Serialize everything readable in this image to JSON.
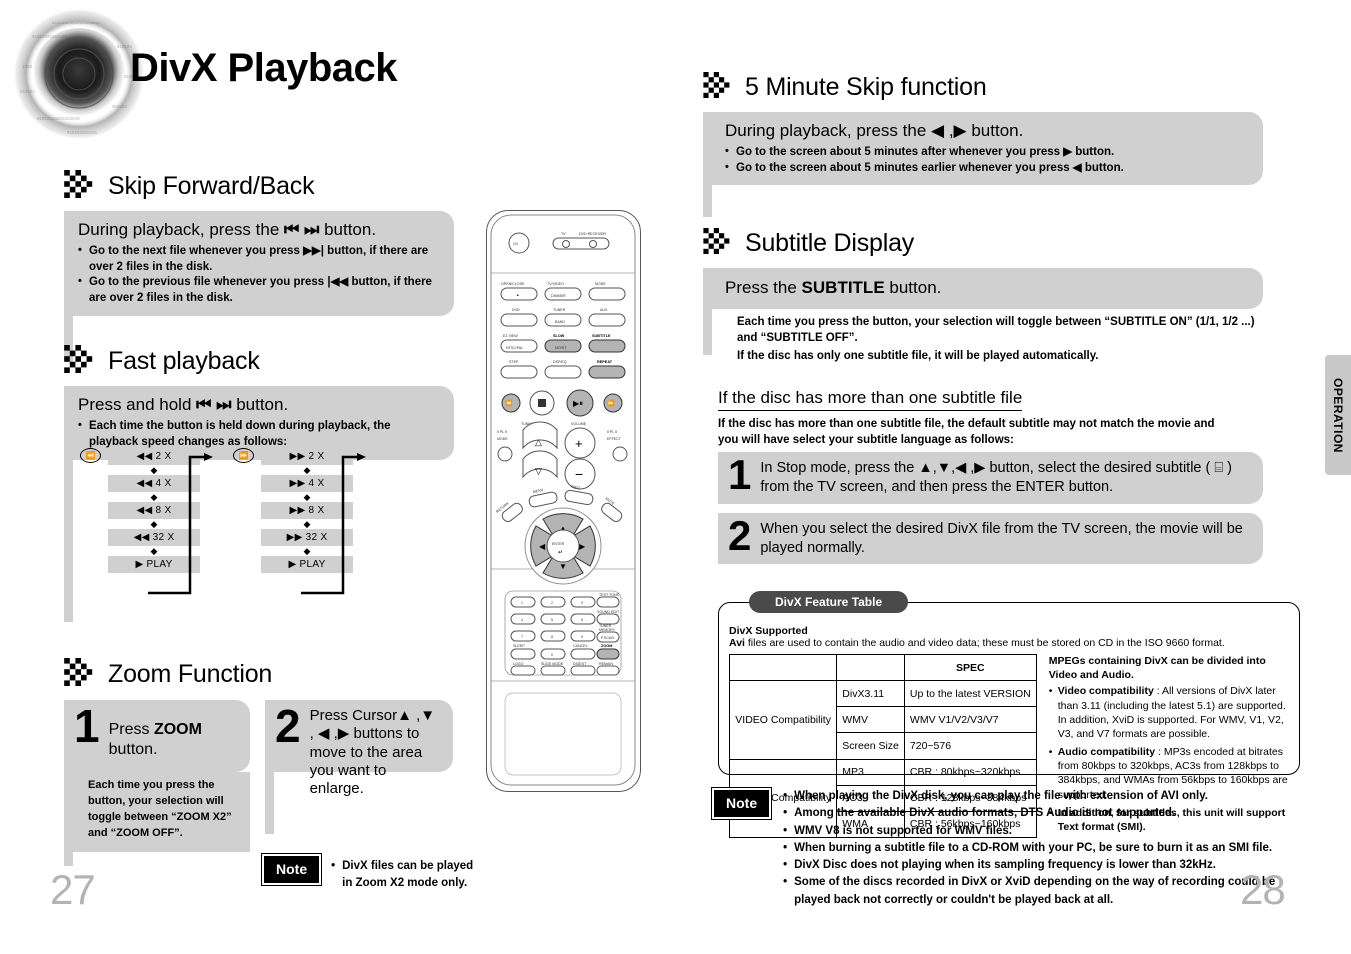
{
  "document": {
    "title": "DivX Playback",
    "side_tab": "OPERATION",
    "left_page_number": "27",
    "right_page_number": "28"
  },
  "sections": {
    "skip": {
      "heading": "Skip Forward/Back",
      "lead_prefix": "During playback, press the",
      "lead_icons": "⏮ ⏭",
      "lead_suffix": "button.",
      "bullets": [
        "Go to the next file whenever you press ▶▶| button, if there are over 2 files in the disk.",
        "Go to the previous file whenever you press |◀◀ button, if there are over 2 files in the disk."
      ]
    },
    "fast": {
      "heading": "Fast playback",
      "lead_prefix": "Press and hold",
      "lead_icons": "⏮ ⏭",
      "lead_suffix": "button.",
      "bullets": [
        "Each time the button is held down during playback, the playback speed changes as follows:"
      ],
      "chain_left": {
        "button_icon": "⏮",
        "steps": [
          "◀◀  2 X",
          "◀◀  4 X",
          "◀◀  8 X",
          "◀◀ 32 X",
          "▶  PLAY"
        ]
      },
      "chain_right": {
        "button_icon": "⏭",
        "steps": [
          "▶▶  2 X",
          "▶▶  4 X",
          "▶▶  8 X",
          "▶▶ 32 X",
          "▶  PLAY"
        ]
      }
    },
    "zoom": {
      "heading": "Zoom Function",
      "step1_num": "1",
      "step1_text_a": "Press ",
      "step1_text_b": "ZOOM",
      "step1_text_c": " button.",
      "step2_num": "2",
      "step2_text": "Press Cursor▲ ,▼ , ◀ ,▶ buttons to move to the area you want to enlarge.",
      "bullet": "Each time you press the button, your selection will toggle between “ZOOM X2” and “ZOOM OFF”.",
      "note_label": "Note",
      "note_text": "DivX files can be played in Zoom X2 mode only."
    },
    "five_min": {
      "heading": "5 Minute Skip function",
      "lead_prefix": "During playback, press the",
      "lead_icons": "◀ ,▶",
      "lead_suffix": "button.",
      "bullets": [
        "Go to the screen about 5 minutes after whenever you press ▶ button.",
        "Go to the screen about 5 minutes earlier whenever you press ◀ button."
      ]
    },
    "subtitle": {
      "heading": "Subtitle Display",
      "lead_a": "Press the ",
      "lead_b": "SUBTITLE",
      "lead_c": " button.",
      "bullets": [
        "Each time you press the button, your selection will toggle between “SUBTITLE ON” (1/1, 1/2 ...) and “SUBTITLE OFF”.",
        "If the disc has only one subtitle file, it will be played automatically."
      ],
      "sub_heading": "If the disc has more than one subtitle file",
      "sub_intro": "If the disc has more than one subtitle file, the default subtitle may not match the movie and you will have select your subtitle language as follows:",
      "step1_num": "1",
      "step1_text": "In Stop mode, press the ▲,▼,◀ ,▶ button, select the desired subtitle ( ⌸ ) from the TV screen, and then press the ENTER button.",
      "step2_num": "2",
      "step2_text": "When you select the desired DivX file from the TV screen, the movie will be played normally."
    },
    "feature_table": {
      "tab_label": "DivX Feature Table",
      "supported_title": "DivX Supported",
      "supported_text_bold": "Avi",
      "supported_text": " files are used to contain the audio and video data; these must be stored on CD in the ISO 9660 format.",
      "table": {
        "header": [
          "",
          "",
          "SPEC"
        ],
        "rows": [
          {
            "group": "VIDEO Compatibility",
            "items": [
              {
                "name": "DivX3.11",
                "spec": "Up to the latest VERSION"
              },
              {
                "name": "WMV",
                "spec": "WMV V1/V2/V3/V7"
              },
              {
                "name": "Screen Size",
                "spec": "720~576"
              }
            ]
          },
          {
            "group": "AUDIO Compatibility",
            "items": [
              {
                "name": "MP3",
                "spec": "CBR : 80kbps~320kbps"
              },
              {
                "name": "AC3",
                "spec": "CBR : 128kbps~384kbps"
              },
              {
                "name": "WMA",
                "spec": "CBR : 56kbps~160kbps"
              }
            ]
          }
        ]
      },
      "right_heading": "MPEGs containing DivX can be divided into Video and Audio.",
      "right_items": [
        {
          "bold": "Video compatibility",
          "text": " : All versions of DivX later than 3.11 (including the latest 5.1) are supported. In addition, XviD is supported. For WMV, V1, V2, V3, and V7 formats are possible."
        },
        {
          "bold": "Audio compatibility",
          "text": " : MP3s encoded at bitrates from 80kbps to 320kbps, AC3s from 128kbps to 384kbps, and WMAs from 56kbps to 160kbps are supported."
        },
        {
          "bold": "In addition, for subtitles, this unit will support Text format (SMI).",
          "text": ""
        }
      ]
    },
    "bottom_note": {
      "label": "Note",
      "items": [
        "When playing the DivX disk, you can play the file with extension of AVI only.",
        "Among the available DivX audio formats, DTS Audio is not supported.",
        "WMV V8 is not supported for WMV files.",
        "When burning a subtitle file to a CD-ROM with your PC, be sure to burn it as an SMI file.",
        "DivX Disc does not playing when its sampling frequency is lower than 32kHz.",
        "Some of the discs recorded in DivX or XviD depending on the way of recording could be played back not correctly or couldn't be played back at all."
      ]
    }
  },
  "remote": {
    "power_icon": "⏻/I",
    "labels": {
      "tv": "TV",
      "dvd_receiver": "DVD RECEIVER",
      "open_close": "OPEN/CLOSE",
      "tv_video": "TV/VIDEO",
      "dimmer": "DIMMER",
      "mode": "MODE",
      "dvd": "DVD",
      "tuner": "TUNER",
      "band": "BAND",
      "aux": "AUX",
      "ez_view": "EZ VIEW",
      "ntsc_pal": "NTSC/PAL",
      "slow": "SLOW",
      "mo_st": "MO/ST",
      "subtitle": "SUBTITLE",
      "step": "STEP",
      "dsp_eq": "DSP/EQ",
      "repeat": "REPEAT",
      "tuning_ch": "TUNING/CH",
      "volume": "VOLUME",
      "pl2_mode": "PL II MODE",
      "pl2_effect": "PL II EFFECT",
      "menu": "MENU",
      "info": "INFO",
      "return": "RETURN",
      "mute": "MUTE",
      "enter": "ENTER",
      "test_tone": "TEST TONE",
      "sound_edit": "SOUND EDIT",
      "tuner_memory": "TUNER MEMORY",
      "p_scan": "P.SCAN",
      "sleep": "SLEEP",
      "cancel": "CANCEL",
      "zoom": "ZOOM",
      "logo": "LOGO",
      "slide_mode": "SLIDE MODE",
      "digest": "DIGEST",
      "remain": "REMAIN",
      "keys": [
        "1",
        "2",
        "3",
        "4",
        "5",
        "6",
        "7",
        "8",
        "9",
        "0"
      ]
    }
  }
}
